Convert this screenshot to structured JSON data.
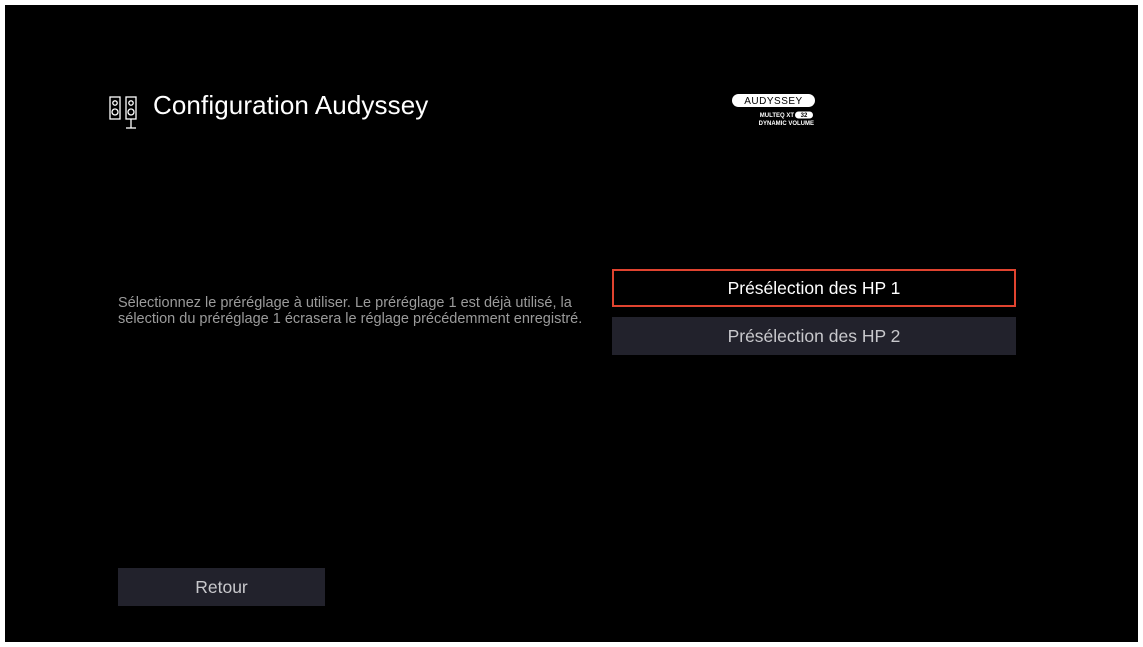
{
  "header": {
    "icon": "speakers-icon",
    "title": "Configuration Audyssey"
  },
  "brand_logo": {
    "name": "AUDYSSEY",
    "line1": "MULTEQ XT32",
    "line2": "DYNAMIC VOLUME"
  },
  "description": "Sélectionnez le préréglage à utiliser. Le préréglage 1 est déjà utilisé, la sélection du préréglage 1 écrasera le réglage précédemment enregistré.",
  "options": [
    {
      "label": "Présélection des HP 1",
      "selected": true
    },
    {
      "label": "Présélection des HP 2",
      "selected": false
    }
  ],
  "back_button": {
    "label": "Retour"
  },
  "colors": {
    "background": "#000000",
    "focus_border": "#e0432f",
    "button_bg": "#22222c",
    "description_text": "#9b9b9b"
  }
}
